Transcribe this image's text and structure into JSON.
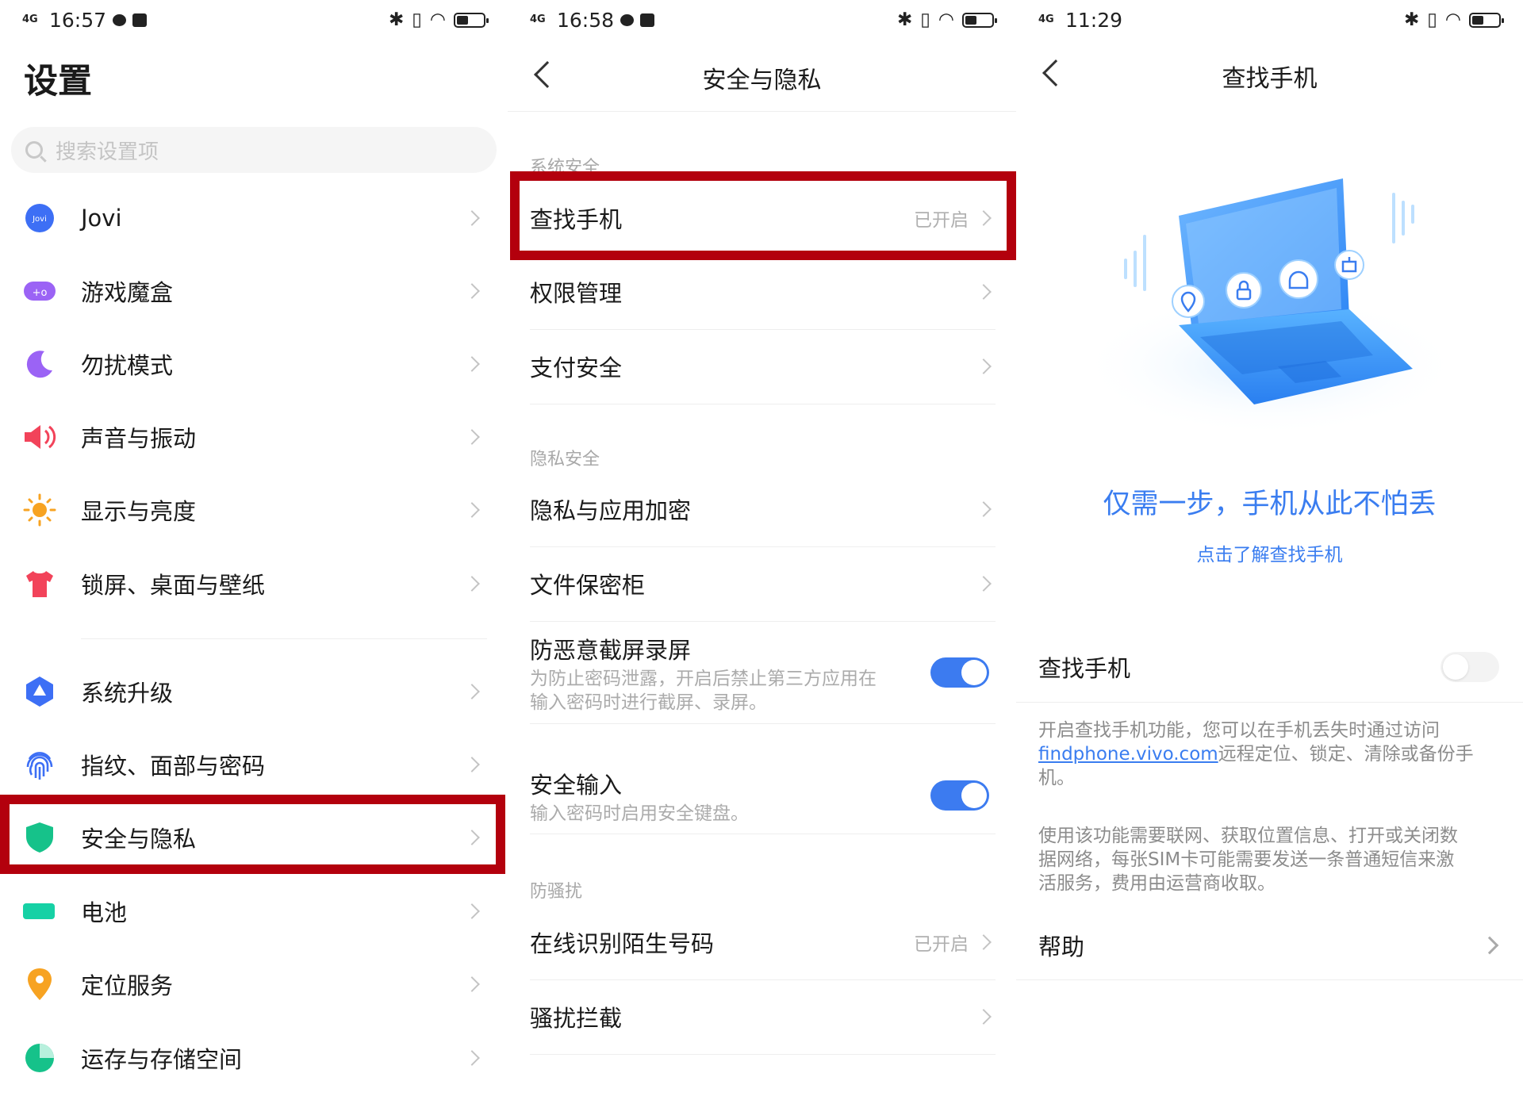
{
  "panel1": {
    "status": {
      "time": "16:57",
      "network": "4G"
    },
    "title": "设置",
    "search_placeholder": "搜索设置项",
    "items": [
      {
        "label": "Jovi",
        "icon": "jovi-icon",
        "color": "#3d6ff5"
      },
      {
        "label": "游戏魔盒",
        "icon": "game-box-icon",
        "color": "#9b63f5"
      },
      {
        "label": "勿扰模式",
        "icon": "moon-icon",
        "color": "#9b63f5"
      },
      {
        "label": "声音与振动",
        "icon": "speaker-icon",
        "color": "#f2435a"
      },
      {
        "label": "显示与亮度",
        "icon": "sun-icon",
        "color": "#f7a322"
      },
      {
        "label": "锁屏、桌面与壁纸",
        "icon": "tshirt-icon",
        "color": "#f2435a"
      },
      {
        "label": "系统升级",
        "icon": "upgrade-icon",
        "color": "#3d6ff5"
      },
      {
        "label": "指纹、面部与密码",
        "icon": "fingerprint-icon",
        "color": "#3d6ff5"
      },
      {
        "label": "安全与隐私",
        "icon": "shield-icon",
        "color": "#16c28a"
      },
      {
        "label": "电池",
        "icon": "battery-icon",
        "color": "#16d1a5"
      },
      {
        "label": "定位服务",
        "icon": "location-pin-icon",
        "color": "#f7a322"
      },
      {
        "label": "运存与存储空间",
        "icon": "pie-chart-icon",
        "color": "#16c28a"
      }
    ]
  },
  "panel2": {
    "status": {
      "time": "16:58",
      "network": "4G"
    },
    "title": "安全与隐私",
    "section_system": "系统安全",
    "find_phone": "查找手机",
    "find_phone_value": "已开启",
    "permissions": "权限管理",
    "payment": "支付安全",
    "section_privacy": "隐私安全",
    "app_encrypt": "隐私与应用加密",
    "file_safe": "文件保密柜",
    "anti_capture": "防恶意截屏录屏",
    "anti_capture_desc1": "为防止密码泄露，开启后禁止第三方应用在",
    "anti_capture_desc2": "输入密码时进行截屏、录屏。",
    "secure_input": "安全输入",
    "secure_input_desc": "输入密码时启用安全键盘。",
    "section_harass": "防骚扰",
    "online_id": "在线识别陌生号码",
    "online_id_value": "已开启",
    "harass_block": "骚扰拦截"
  },
  "panel3": {
    "status": {
      "time": "11:29",
      "network": "4G"
    },
    "title": "查找手机",
    "slogan": "仅需一步，手机从此不怕丢",
    "learn_more": "点击了解查找手机",
    "toggle_label": "查找手机",
    "desc1_a": "开启查找手机功能，您可以在手机丢失时通过访问",
    "desc1_link": "findphone.vivo.com",
    "desc1_b": "远程定位、锁定、清除或备份手",
    "desc1_c": "机。",
    "desc2_a": "使用该功能需要联网、获取位置信息、打开或关闭数",
    "desc2_b": "据网络，每张SIM卡可能需要发送一条普通短信来激",
    "desc2_c": "活服务，费用由运营商收取。",
    "help": "帮助"
  },
  "colors": {
    "accent": "#3a7df0",
    "highlight": "#b3000d"
  }
}
